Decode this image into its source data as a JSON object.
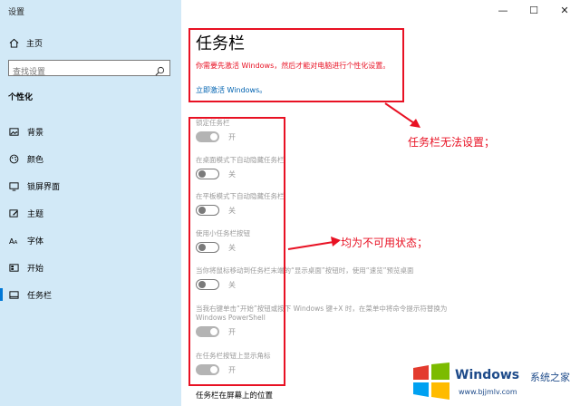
{
  "app": {
    "title": "设置"
  },
  "window_controls": {
    "minimize": "—",
    "maximize": "☐",
    "close": "✕"
  },
  "sidebar": {
    "home_label": "主页",
    "search_placeholder": "查找设置",
    "category": "个性化",
    "items": [
      {
        "label": "背景",
        "icon": "image-icon"
      },
      {
        "label": "颜色",
        "icon": "palette-icon"
      },
      {
        "label": "锁屏界面",
        "icon": "lock-screen-icon"
      },
      {
        "label": "主题",
        "icon": "brush-icon"
      },
      {
        "label": "字体",
        "icon": "font-icon"
      },
      {
        "label": "开始",
        "icon": "start-icon"
      },
      {
        "label": "任务栏",
        "icon": "taskbar-icon",
        "active": true
      }
    ]
  },
  "main": {
    "title": "任务栏",
    "warning": "你需要先激活 Windows，然后才能对电脑进行个性化设置。",
    "activate_link": "立即激活 Windows。",
    "settings": [
      {
        "label": "锁定任务栏",
        "state": "开",
        "on": true
      },
      {
        "label": "在桌面模式下自动隐藏任务栏",
        "state": "关",
        "on": false
      },
      {
        "label": "在平板模式下自动隐藏任务栏",
        "state": "关",
        "on": false
      },
      {
        "label": "使用小任务栏按钮",
        "state": "关",
        "on": false
      },
      {
        "label": "当你将鼠标移动到任务栏末端的“显示桌面”按钮时，使用“速览”预览桌面",
        "state": "关",
        "on": false
      },
      {
        "label": "当我右键单击“开始”按钮或按下 Windows 键+X 时，在菜单中将命令提示符替换为 Windows PowerShell",
        "state": "开",
        "on": true
      },
      {
        "label": "在任务栏按钮上显示角标",
        "state": "开",
        "on": true
      }
    ],
    "section_title": "任务栏在屏幕上的位置"
  },
  "annotations": {
    "note1": "任务栏无法设置；",
    "note2": "均为不可用状态；"
  },
  "watermark": {
    "title": "Windows",
    "cn": "系统之家",
    "url": "www.bjjmlv.com"
  },
  "colors": {
    "accent": "#0078d7",
    "annotation": "#e81123",
    "sidebar_bg": "#d2e9f7"
  }
}
